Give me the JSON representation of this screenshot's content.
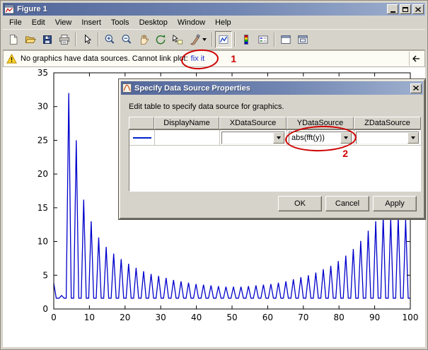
{
  "window": {
    "title": "Figure 1"
  },
  "menu": {
    "items": [
      "File",
      "Edit",
      "View",
      "Insert",
      "Tools",
      "Desktop",
      "Window",
      "Help"
    ]
  },
  "toolbar": {
    "icons": [
      "new-figure",
      "open-file",
      "save-figure",
      "print-figure",
      "pointer",
      "zoom-in",
      "zoom-out",
      "pan",
      "rotate-3d",
      "data-cursor",
      "brush",
      "link-plot",
      "insert-colorbar",
      "insert-legend",
      "hide-plot-tools",
      "show-plot-tools-and-dock"
    ]
  },
  "infobar": {
    "message": "No graphics have data sources. Cannot link plot:",
    "link_label": "fix it",
    "annotation_number": "1"
  },
  "dialog": {
    "title": "Specify Data Source Properties",
    "instruction": "Edit table to specify data source for graphics.",
    "table": {
      "columns": [
        "",
        "DisplayName",
        "XDataSource",
        "YDataSource",
        "ZDataSource"
      ],
      "rows": [
        {
          "display_name": "",
          "x_data_source": "",
          "y_data_source": "abs(fft(y))",
          "z_data_source": ""
        }
      ]
    },
    "buttons": {
      "ok": "OK",
      "cancel": "Cancel",
      "apply": "Apply"
    },
    "annotation_number": "2"
  },
  "chart_data": {
    "type": "line",
    "title": "",
    "xlabel": "",
    "ylabel": "",
    "series_name": "abs(fft(y))",
    "line_color": "#0000cc",
    "grid": false,
    "xlim": [
      0,
      100
    ],
    "ylim": [
      0,
      35
    ],
    "xticks": [
      0,
      10,
      20,
      30,
      40,
      50,
      60,
      70,
      80,
      90,
      100
    ],
    "yticks": [
      0,
      5,
      10,
      15,
      20,
      25,
      30,
      35
    ],
    "baseline": 1.6,
    "spikes": [
      [
        0,
        3.8
      ],
      [
        2.2,
        2.0
      ],
      [
        4.2,
        32
      ],
      [
        6.3,
        25
      ],
      [
        8.4,
        16.2
      ],
      [
        10.5,
        13
      ],
      [
        12.6,
        10.6
      ],
      [
        14.7,
        9.2
      ],
      [
        16.8,
        8.2
      ],
      [
        18.9,
        7.4
      ],
      [
        21,
        6.7
      ],
      [
        23.1,
        6.1
      ],
      [
        25.2,
        5.6
      ],
      [
        27.3,
        5.2
      ],
      [
        29.4,
        4.9
      ],
      [
        31.5,
        4.6
      ],
      [
        33.6,
        4.3
      ],
      [
        35.7,
        4.1
      ],
      [
        37.8,
        3.9
      ],
      [
        39.9,
        3.7
      ],
      [
        42,
        3.6
      ],
      [
        44.1,
        3.5
      ],
      [
        46.2,
        3.4
      ],
      [
        48.3,
        3.3
      ],
      [
        50.4,
        3.3
      ],
      [
        52.5,
        3.3
      ],
      [
        54.6,
        3.4
      ],
      [
        56.7,
        3.5
      ],
      [
        58.8,
        3.6
      ],
      [
        60.9,
        3.7
      ],
      [
        63,
        3.9
      ],
      [
        65.1,
        4.1
      ],
      [
        67.2,
        4.4
      ],
      [
        69.3,
        4.7
      ],
      [
        71.4,
        5.0
      ],
      [
        73.5,
        5.4
      ],
      [
        75.6,
        5.9
      ],
      [
        77.7,
        6.4
      ],
      [
        79.8,
        7.1
      ],
      [
        81.9,
        7.9
      ],
      [
        84,
        8.9
      ],
      [
        86.1,
        10.1
      ],
      [
        88.2,
        11.6
      ],
      [
        90.3,
        13.0
      ],
      [
        92.4,
        13.6
      ],
      [
        94.5,
        13.4
      ],
      [
        96.6,
        13.6
      ],
      [
        98.7,
        13.2
      ]
    ]
  }
}
